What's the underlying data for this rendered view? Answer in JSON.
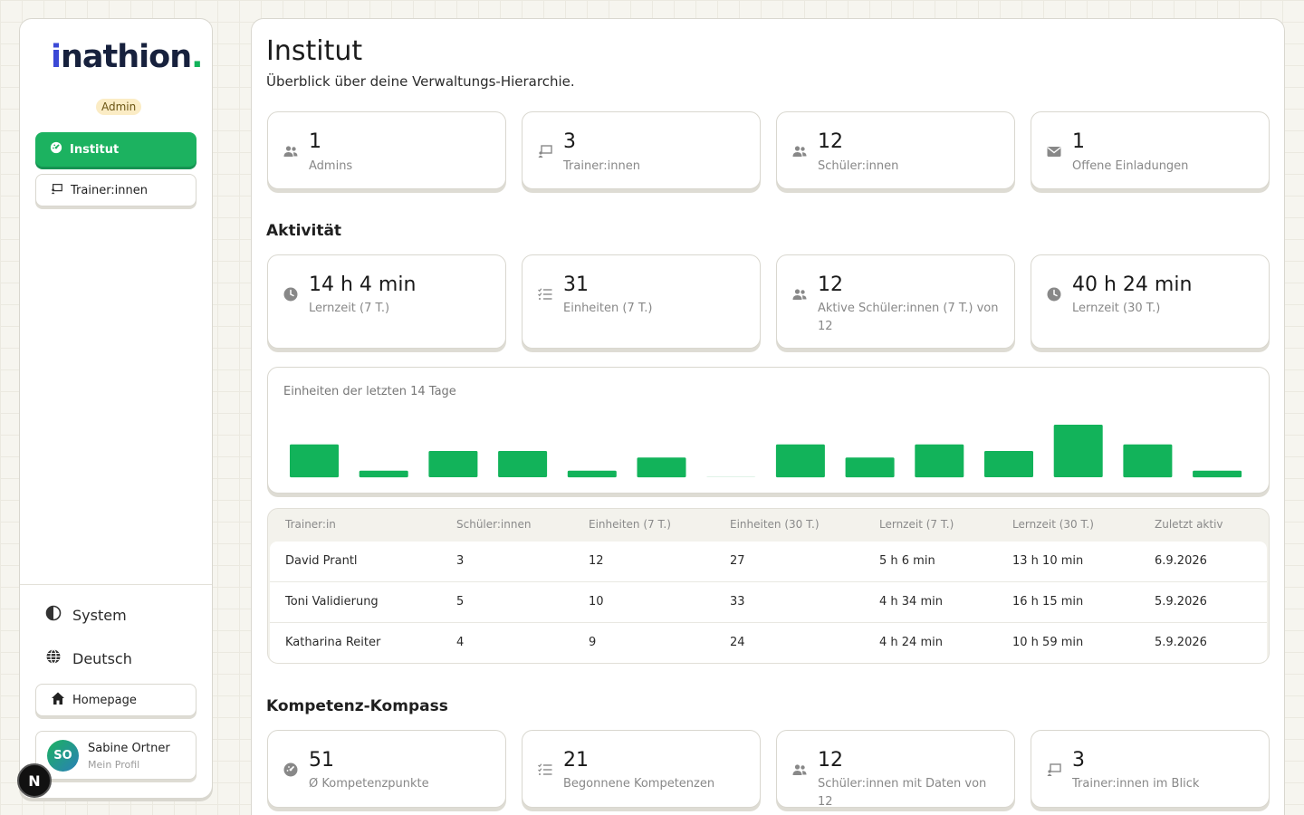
{
  "sidebar": {
    "logo": {
      "text": "nathion",
      "prefix": "i",
      "dot": "."
    },
    "role_badge": "Admin",
    "nav": [
      {
        "label": "Institut",
        "icon": "gauge-icon"
      },
      {
        "label": "Trainer:innen",
        "icon": "chalkboard-icon"
      }
    ],
    "system_label": "System",
    "language_label": "Deutsch",
    "homepage_label": "Homepage",
    "profile": {
      "initials": "SO",
      "name": "Sabine Ortner",
      "subtitle": "Mein Profil"
    },
    "n_badge": "N"
  },
  "main": {
    "title": "Institut",
    "subtitle": "Überblick über deine Verwaltungs-Hierarchie.",
    "overview_cards": [
      {
        "value": "1",
        "label": "Admins",
        "icon": "users-icon"
      },
      {
        "value": "3",
        "label": "Trainer:innen",
        "icon": "chalkboard-icon"
      },
      {
        "value": "12",
        "label": "Schüler:innen",
        "icon": "users-icon"
      },
      {
        "value": "1",
        "label": "Offene Einladungen",
        "icon": "envelope-icon"
      }
    ],
    "activity_title": "Aktivität",
    "activity_cards": [
      {
        "value": "14 h 4 min",
        "label": "Lernzeit (7 T.)",
        "icon": "clock-icon"
      },
      {
        "value": "31",
        "label": "Einheiten (7 T.)",
        "icon": "list-icon"
      },
      {
        "value": "12",
        "label": "Aktive Schüler:innen (7 T.) von 12",
        "icon": "users-icon"
      },
      {
        "value": "40 h 24 min",
        "label": "Lernzeit (30 T.)",
        "icon": "clock-icon"
      }
    ],
    "chart_title": "Einheiten der letzten 14 Tage",
    "table": {
      "headers": [
        "Trainer:in",
        "Schüler:innen",
        "Einheiten (7 T.)",
        "Einheiten (30 T.)",
        "Lernzeit (7 T.)",
        "Lernzeit (30 T.)",
        "Zuletzt aktiv"
      ],
      "rows": [
        [
          "David Prantl",
          "3",
          "12",
          "27",
          "5 h 6 min",
          "13 h 10 min",
          "6.9.2026"
        ],
        [
          "Toni Validierung",
          "5",
          "10",
          "33",
          "4 h 34 min",
          "16 h 15 min",
          "5.9.2026"
        ],
        [
          "Katharina Reiter",
          "4",
          "9",
          "24",
          "4 h 24 min",
          "10 h 59 min",
          "5.9.2026"
        ]
      ]
    },
    "compass_title": "Kompetenz-Kompass",
    "compass_cards": [
      {
        "value": "51",
        "label": "Ø Kompetenzpunkte",
        "icon": "gauge-icon"
      },
      {
        "value": "21",
        "label": "Begonnene Kompetenzen",
        "icon": "list-icon"
      },
      {
        "value": "12",
        "label": "Schüler:innen mit Daten von 12",
        "icon": "users-icon"
      },
      {
        "value": "3",
        "label": "Trainer:innen im Blick",
        "icon": "chalkboard-icon"
      }
    ]
  },
  "colors": {
    "accent": "#1cb260",
    "bar": "#12b35a",
    "text_muted": "#888888"
  },
  "chart_data": {
    "type": "bar",
    "categories": [],
    "values": [
      5,
      1,
      4,
      4,
      1,
      3,
      0,
      5,
      3,
      5,
      4,
      8,
      5,
      1
    ],
    "title": "Einheiten der letzten 14 Tage",
    "xlabel": "",
    "ylabel": "",
    "grid": false
  }
}
